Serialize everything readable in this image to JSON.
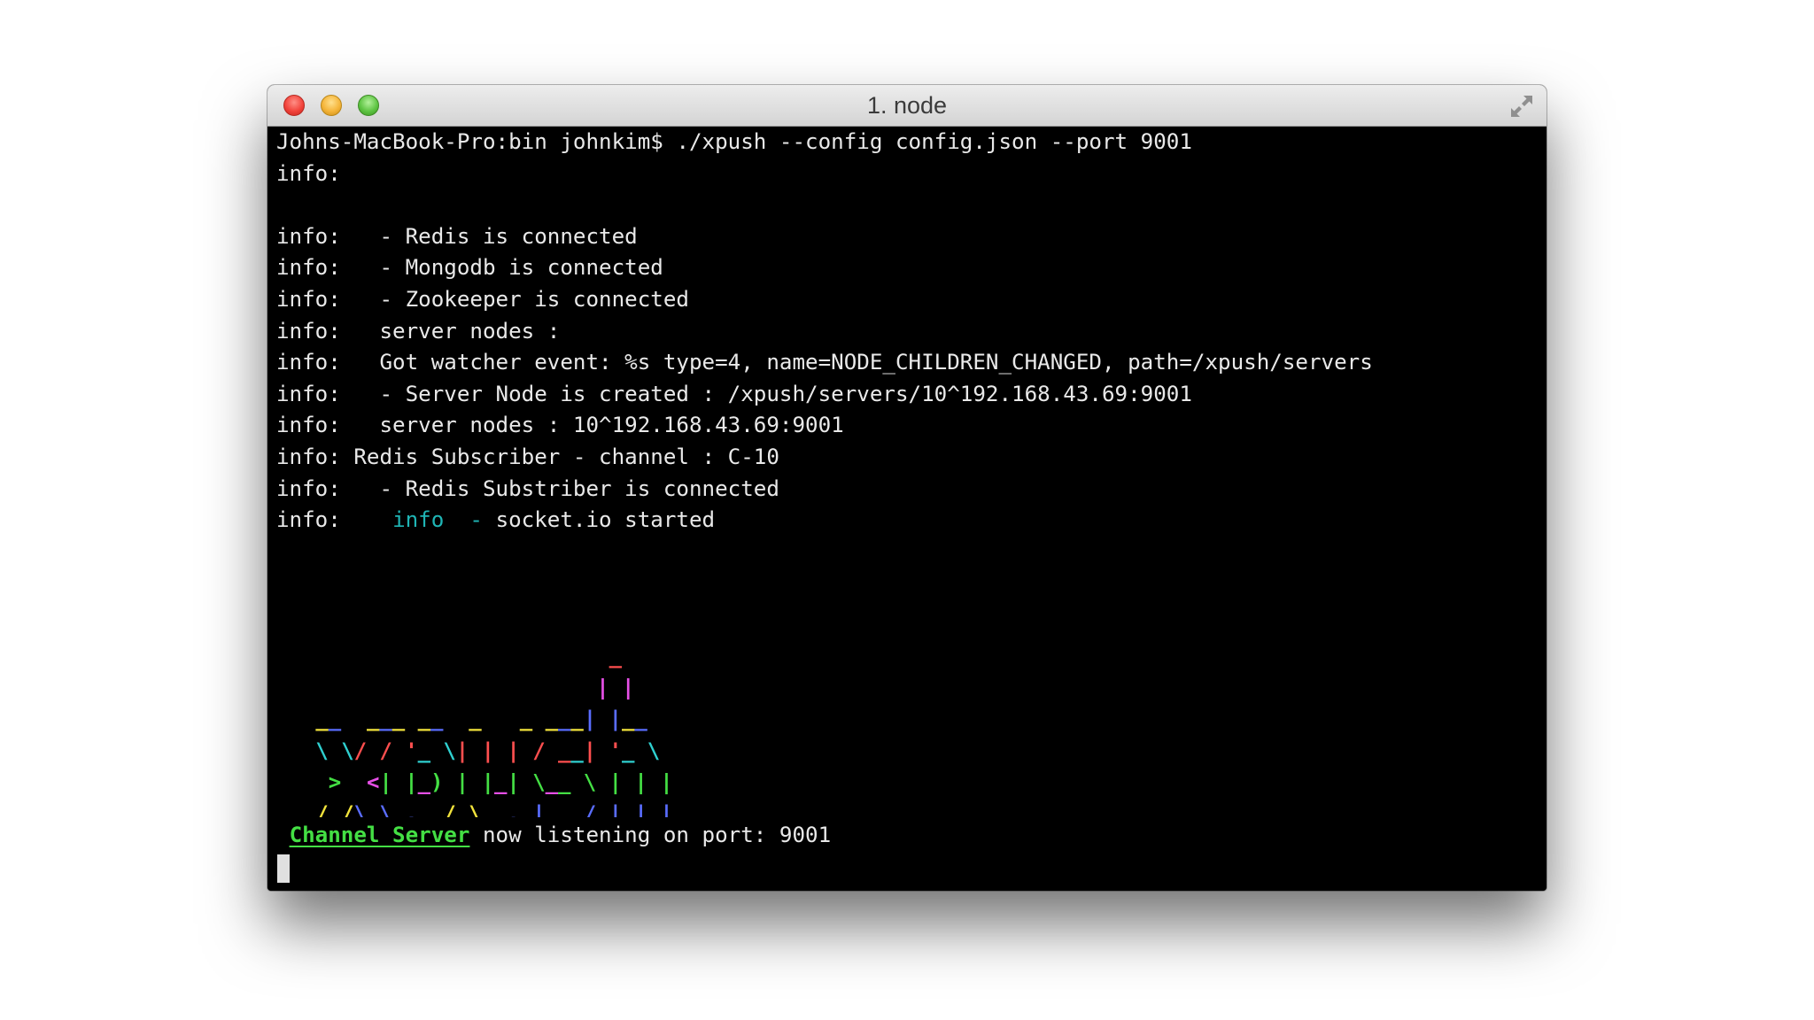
{
  "window": {
    "title": "1. node",
    "controls": {
      "close": "close-button",
      "minimize": "minimize-button",
      "zoom": "zoom-button"
    },
    "fullscreen_icon": "fullscreen-arrows-icon"
  },
  "colors": {
    "terminal_bg": "#000000",
    "text": "#e9e9e9",
    "info_cyan": "#1fb5b5",
    "channel_green": "#44df44",
    "logo_yellow": "#f2e33c",
    "logo_green": "#44df44",
    "logo_blue": "#5a6dff",
    "logo_red": "#ff4f4f",
    "logo_cyan": "#2fd0d0",
    "logo_magenta": "#e64fe6"
  },
  "terminal": {
    "prompt": "Johns-MacBook-Pro:bin johnkim$",
    "command": "./xpush --config config.json --port 9001",
    "log": [
      "info:",
      "",
      "info:   - Redis is connected",
      "info:   - Mongodb is connected",
      "info:   - Zookeeper is connected",
      "info:   server nodes :",
      "info:   Got watcher event: %s type=4, name=NODE_CHILDREN_CHANGED, path=/xpush/servers",
      "info:   - Server Node is created : /xpush/servers/10^192.168.43.69:9001",
      "info:   server nodes : 10^192.168.43.69:9001",
      "info: Redis Subscriber - channel : C-10",
      "info:   - Redis Substriber is connected"
    ],
    "socket_line": {
      "prefix": "info:    ",
      "tag": "info",
      "dash": "  - ",
      "message": "socket.io started"
    },
    "listening": {
      "name": "Channel Server",
      "message": " now listening on port: 9001"
    },
    "logo_rows": [
      "                        _",
      "                       | |",
      " __  ___ __  _   _ ___| |__",
      " \\ \\/ / '_ \\| | | / __| '_ \\",
      "  >  <| |_) | |_| \\__ \\ | | |",
      " /_/\\_\\ .__/ \\__,_|___/_| |_|",
      "      | |",
      "      |_|"
    ]
  }
}
